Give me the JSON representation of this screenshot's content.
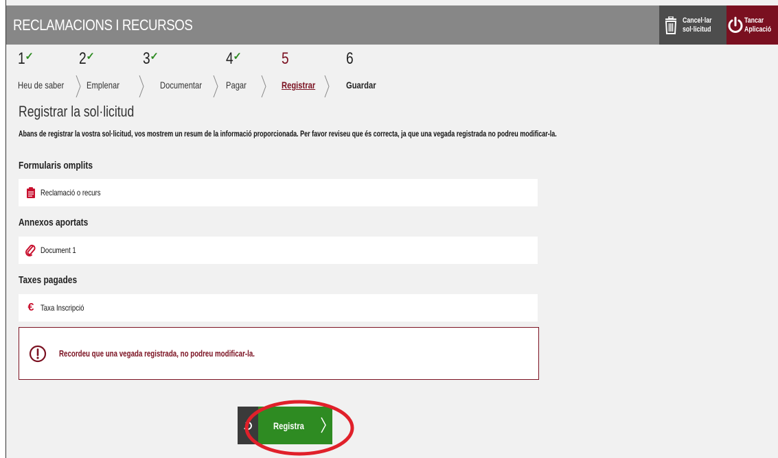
{
  "header": {
    "title": "RECLAMACIONS I RECURSOS",
    "cancel_line1": "Cancel·lar",
    "cancel_line2": "sol·licitud",
    "close_line1": "Tancar",
    "close_line2": "Aplicació"
  },
  "steps": [
    {
      "number": "1",
      "label": "Heu de saber",
      "done": true
    },
    {
      "number": "2",
      "label": "Emplenar",
      "done": true
    },
    {
      "number": "3",
      "label": "Documentar",
      "done": true
    },
    {
      "number": "4",
      "label": "Pagar",
      "done": true
    },
    {
      "number": "5",
      "label": "Registrar",
      "active": true
    },
    {
      "number": "6",
      "label": "Guardar"
    }
  ],
  "page_title": "Registrar la sol·licitud",
  "intro": "Abans de registrar la vostra sol·licitud, vos mostrem un resum de la informació proporcionada. Per favor reviseu que és correcta, ja que una vegada registrada no podreu modificar-la.",
  "sections": {
    "forms_title": "Formularis omplits",
    "form_item": "Reclamació o recurs",
    "attachments_title": "Annexos aportats",
    "attachment_item": "Document 1",
    "fees_title": "Taxes pagades",
    "fee_item": "Taxa Inscripció"
  },
  "warning": "Recordeu que una vegada registrada, no podreu modificar-la.",
  "register_button": "Registra",
  "colors": {
    "header_bg": "#878787",
    "brand": "#7a1020",
    "check": "#2e8b22",
    "register_bg": "#2e8b22",
    "highlight": "#e0202a"
  }
}
